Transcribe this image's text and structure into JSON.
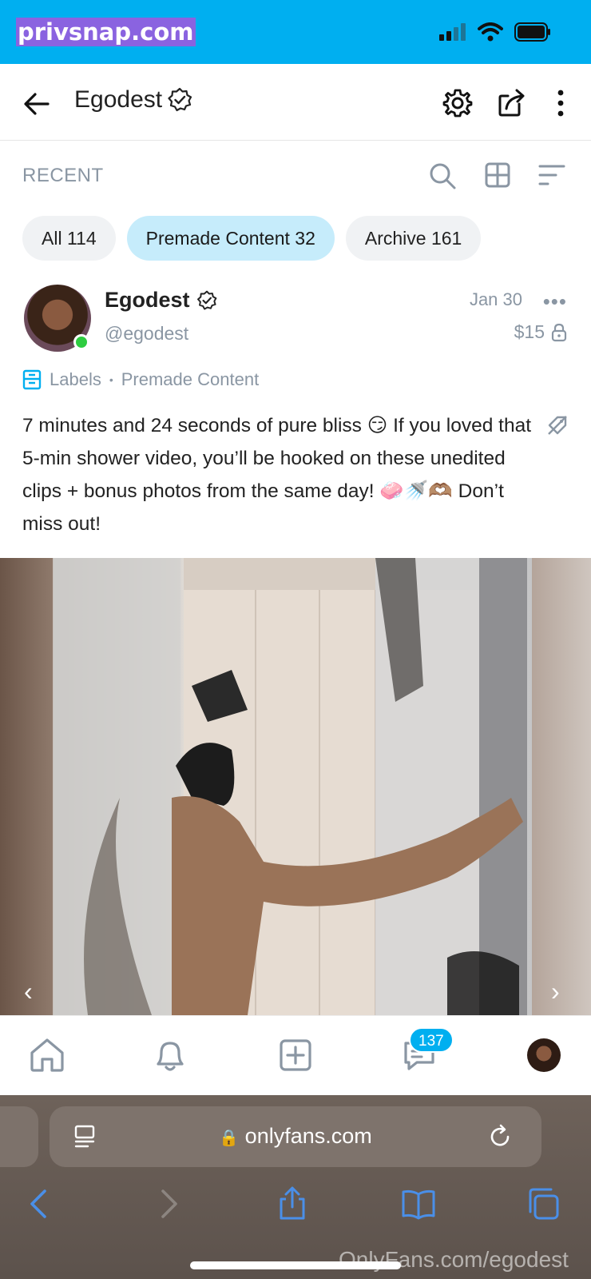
{
  "watermark_top": "privsnap.com",
  "header": {
    "title": "Egodest"
  },
  "section": {
    "label": "RECENT"
  },
  "chips": [
    {
      "label": "All 114"
    },
    {
      "label": "Premade Content 32"
    },
    {
      "label": "Archive 161"
    }
  ],
  "post": {
    "name": "Egodest",
    "handle": "@egodest",
    "date": "Jan 30",
    "price": "$15",
    "labels_text": "Labels",
    "label_value": "Premade Content",
    "text": "7 minutes and 24 seconds of pure bliss 😏 If you loved that 5-min shower video, you’ll be hooked on these unedited clips + bonus photos from the same day! 🧼🚿🫶🏽 Don’t miss out!"
  },
  "bottom_nav": {
    "messages_badge": "137"
  },
  "browser": {
    "url": "onlyfans.com"
  },
  "watermark_bottom": "OnlyFans.com/egodest",
  "colors": {
    "brand": "#00aff0",
    "chip_active": "#c6ecfb",
    "muted": "#8a96a3"
  }
}
